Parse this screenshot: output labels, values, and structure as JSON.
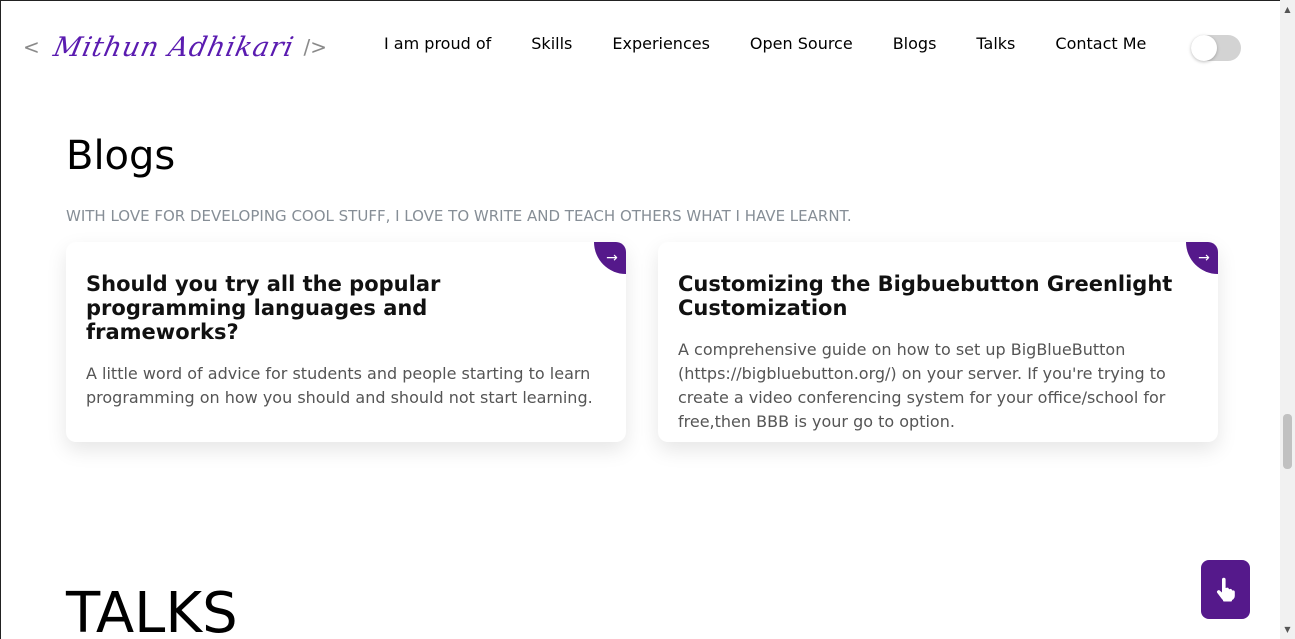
{
  "header": {
    "logo": {
      "open": "<",
      "signature": "Mithun Adhikari",
      "close": "/>"
    },
    "nav": [
      "I am proud of",
      "Skills",
      "Experiences",
      "Open Source",
      "Blogs",
      "Talks",
      "Contact Me"
    ]
  },
  "blogs": {
    "title": "Blogs",
    "subtitle": "WITH LOVE FOR DEVELOPING COOL STUFF, I LOVE TO WRITE AND TEACH OTHERS WHAT I HAVE LEARNT.",
    "cards": [
      {
        "title": "Should you try all the popular programming languages and frameworks?",
        "description": "A little word of advice for students and people starting to learn programming on how you should and should not start learning.",
        "arrow": "→"
      },
      {
        "title": "Customizing the Bigbuebutton Greenlight Customization",
        "description": "A comprehensive guide on how to set up BigBlueButton (https://bigbluebutton.org/) on your server. If you're trying to create a video conferencing system for your office/school for free,then BBB is your go to option.",
        "arrow": "→"
      }
    ]
  },
  "talks": {
    "title": "TALKS"
  },
  "colors": {
    "accent": "#55198b",
    "subtitle": "#868e96"
  },
  "icons": {
    "fab": "pointing-hand-icon",
    "toggle": "theme-toggle"
  }
}
